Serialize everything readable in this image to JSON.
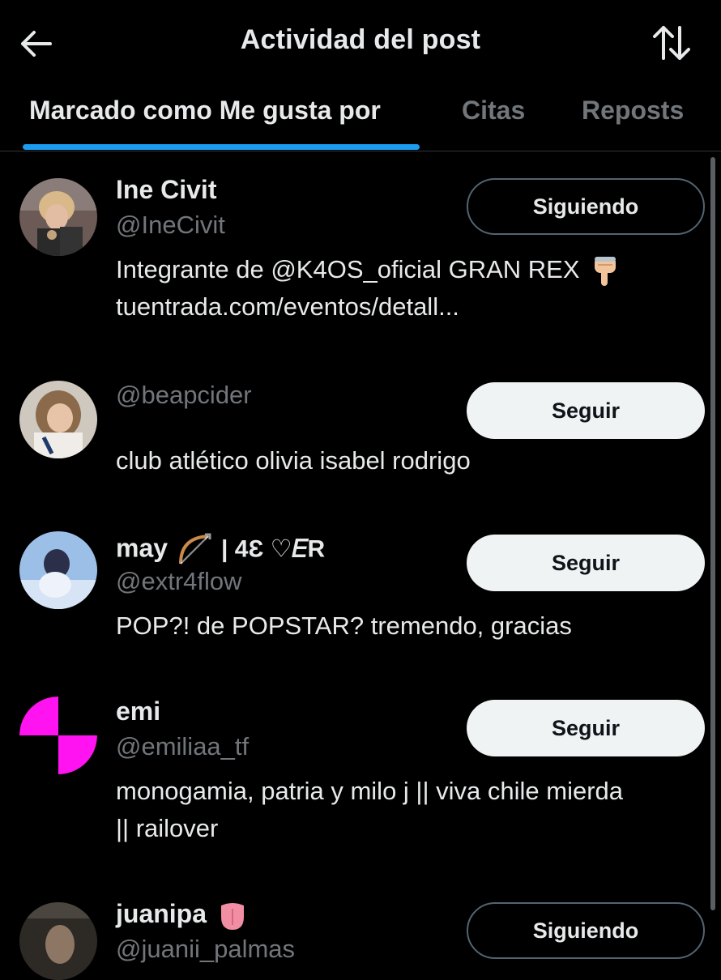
{
  "header": {
    "title": "Actividad del post",
    "back_icon": "arrow-left-icon",
    "sort_icon": "sort-arrows-icon"
  },
  "tabs": [
    {
      "label": "Marcado como Me gusta por",
      "active": true
    },
    {
      "label": "Citas",
      "active": false
    },
    {
      "label": "Reposts",
      "active": false
    }
  ],
  "colors": {
    "accent": "#1d9bf0",
    "background": "#000000",
    "text_primary": "#e7e9ea",
    "text_secondary": "#71767b"
  },
  "users": [
    {
      "name": "Ine Civit",
      "handle": "@IneCivit",
      "bio": "Integrante de @K4OS_oficial GRAN REX",
      "bio_line2": "tuentrada.com/eventos/detall...",
      "bio_emoji": "pointing-down-hand-icon",
      "button": "Siguiendo",
      "following": true
    },
    {
      "name": "",
      "handle": "@beapcider",
      "bio": "club atlético olivia isabel rodrigo",
      "button": "Seguir",
      "following": false
    },
    {
      "name": "may",
      "name_suffix": "| 4Ɛ ♡𝐸R",
      "name_emoji": "bow-and-arrow-icon",
      "handle": "@extr4flow",
      "bio": "POP?! de POPSTAR? tremendo, gracias",
      "button": "Seguir",
      "following": false
    },
    {
      "name": "emi",
      "handle": "@emiliaa_tf",
      "bio": "monogamia, patria y milo j || viva chile mierda",
      "bio_line2": "|| railover",
      "button": "Seguir",
      "following": false
    },
    {
      "name": "juanipa",
      "name_emoji": "tongue-icon",
      "handle": "@juanii_palmas",
      "button": "Siguiendo",
      "following": true
    }
  ]
}
